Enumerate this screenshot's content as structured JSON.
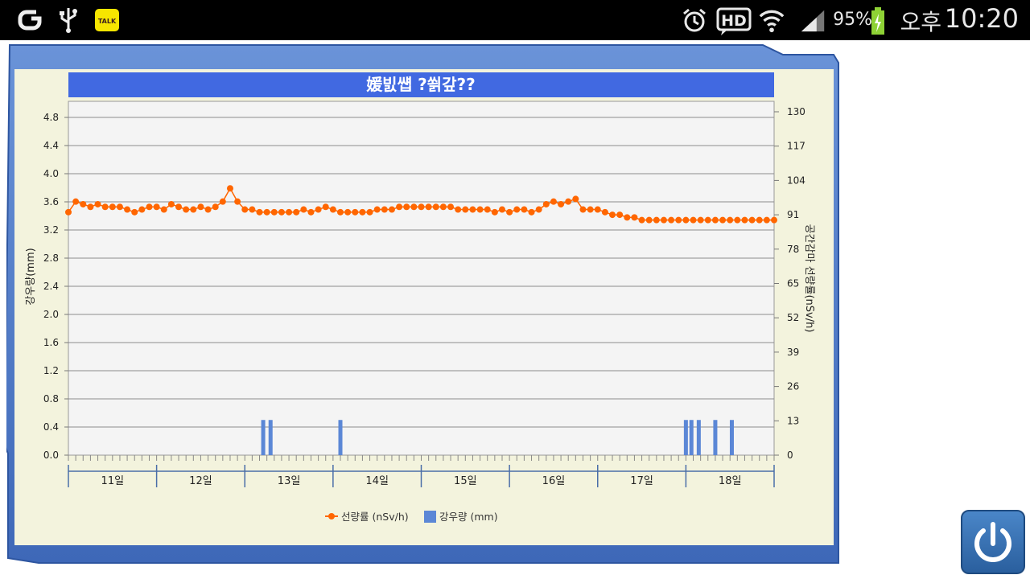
{
  "status_bar": {
    "battery": "95%",
    "ampm": "오후",
    "time": "10:20",
    "hd": "HD",
    "kakao": "TALK",
    "icons": [
      "g-app-icon",
      "usb-icon",
      "kakaotalk-icon",
      "alarm-icon",
      "hd-voice-icon",
      "wifi-icon",
      "signal-icon",
      "battery-icon"
    ]
  },
  "colors": {
    "title_bg": "#4169e1",
    "line": "#ff6600",
    "bar": "#5b87d6",
    "panel": "#f3f3dd",
    "plot_bg": "#f4f4f4",
    "frame": "#4a76c8"
  },
  "chart_data": {
    "type": "line",
    "title": "媛빐썝 ?쐵갚??",
    "ylabel": "강우량(mm)",
    "y2label": "공간감마 선량률(nSv/h)",
    "categories": [
      "11일",
      "12일",
      "13일",
      "14일",
      "15일",
      "16일",
      "17일",
      "18일"
    ],
    "ylim": [
      0,
      4.8
    ],
    "y_ticks": [
      "0.0",
      "0.4",
      "0.8",
      "1.2",
      "1.6",
      "2.0",
      "2.4",
      "2.8",
      "3.2",
      "3.6",
      "4.0",
      "4.4",
      "4.8"
    ],
    "y2lim": [
      0,
      130
    ],
    "y2_ticks": [
      "0",
      "13",
      "26",
      "39",
      "52",
      "65",
      "78",
      "91",
      "104",
      "117",
      "130"
    ],
    "grid": true,
    "legend_position": "bottom",
    "x_unit": "hours since 11일 00:00",
    "series": [
      {
        "name": "선량률 (nSv/h)",
        "axis": "right",
        "type": "line",
        "x": [
          0,
          2,
          4,
          6,
          8,
          10,
          12,
          14,
          16,
          18,
          20,
          22,
          24,
          26,
          28,
          30,
          32,
          34,
          36,
          38,
          40,
          42,
          44,
          46,
          48,
          50,
          52,
          54,
          56,
          58,
          60,
          62,
          64,
          66,
          68,
          70,
          72,
          74,
          76,
          78,
          80,
          82,
          84,
          86,
          88,
          90,
          92,
          94,
          96,
          98,
          100,
          102,
          104,
          106,
          108,
          110,
          112,
          114,
          116,
          118,
          120,
          122,
          124,
          126,
          128,
          130,
          132,
          134,
          136,
          138,
          140,
          142,
          144,
          146,
          148,
          150,
          152,
          154,
          156,
          158,
          160,
          162,
          164,
          166,
          168,
          170,
          172,
          174,
          176,
          178,
          180,
          182,
          184,
          186,
          188,
          190,
          192
        ],
        "values": [
          92,
          96,
          95,
          94,
          95,
          94,
          94,
          94,
          93,
          92,
          94,
          94,
          96,
          95,
          93,
          93,
          93,
          94,
          93,
          93,
          94,
          96,
          101,
          96,
          93,
          93,
          92,
          92,
          92,
          92,
          93,
          92,
          92,
          93,
          92,
          94,
          95,
          92,
          92,
          92,
          92,
          92,
          93,
          93,
          94,
          94,
          94,
          94,
          95,
          96,
          95,
          95,
          94,
          93,
          93,
          93,
          93,
          93,
          92,
          93,
          92,
          93,
          93,
          92,
          93,
          96,
          97,
          95,
          96,
          97,
          94,
          93,
          93,
          92,
          91,
          91,
          90,
          90,
          90,
          89,
          89,
          89,
          89,
          89,
          89,
          89,
          89,
          89,
          89,
          89,
          89,
          90,
          91,
          92,
          92,
          93,
          93
        ],
        "values_resampled": [
          92,
          96,
          95,
          94,
          95,
          94,
          94,
          94,
          93,
          92,
          93,
          94,
          94,
          93,
          95,
          94,
          93,
          93,
          94,
          93,
          94,
          96,
          101,
          96,
          93,
          93,
          92,
          92,
          92,
          92,
          92,
          92,
          93,
          92,
          93,
          94,
          93,
          92,
          92,
          92,
          92,
          92,
          93,
          93,
          93,
          94,
          94,
          94,
          94,
          94,
          94,
          94,
          94,
          93,
          93,
          93,
          93,
          93,
          92,
          93,
          92,
          93,
          93,
          92,
          93,
          95,
          96,
          95,
          96,
          97,
          93,
          93,
          93,
          92,
          91,
          91,
          90,
          90,
          89,
          89,
          89,
          89,
          89,
          89,
          89,
          89,
          89,
          89,
          89,
          89,
          89,
          89,
          89,
          89,
          89,
          89,
          89
        ]
      },
      {
        "name": "강우량 (mm)",
        "axis": "left",
        "type": "bar",
        "x": [
          53,
          55,
          74,
          168,
          169.5,
          171.5,
          176,
          180.5
        ],
        "values": [
          0.5,
          0.5,
          0.5,
          0.5,
          0.5,
          0.5,
          0.5,
          0.5
        ]
      }
    ]
  }
}
